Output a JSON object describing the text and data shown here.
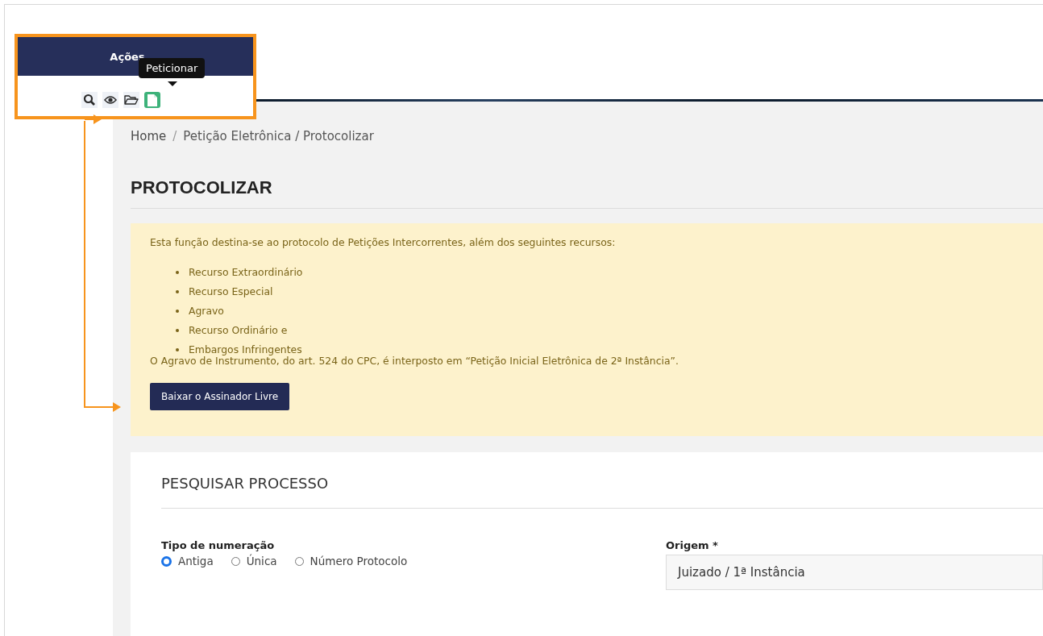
{
  "breadcrumb": [
    {
      "kind": "link",
      "text": "Home"
    },
    {
      "kind": "separator",
      "text": "/"
    },
    {
      "kind": "current",
      "text": "Petição Eletrônica / Protocolizar"
    }
  ],
  "title": "PROTOCOLIZAR",
  "alert": {
    "intro": "Esta função destina-se ao protocolo de Petições Intercorrentes, além dos seguintes recursos:",
    "items": [
      "Recurso Extraordinário",
      "Recurso Especial",
      "Agravo",
      "Recurso Ordinário e",
      "Embargos Infringentes"
    ],
    "note": "O Agravo de Instrumento, do art. 524 do CPC, é interposto em “Petição Inicial Eletrônica de 2ª Instância”.",
    "button": "Baixar o Assinador Livre"
  },
  "search_card": {
    "title": "PESQUISAR PROCESSO",
    "numbering": {
      "label": "Tipo de numeração",
      "options": [
        {
          "label": "Antiga",
          "selected": true
        },
        {
          "label": "Única",
          "selected": false
        },
        {
          "label": "Número Protocolo",
          "selected": false
        }
      ]
    },
    "origin": {
      "label": "Origem *",
      "value": "Juizado / 1ª Instância"
    }
  },
  "callout": {
    "header": "Ações",
    "tooltip": "Peticionar",
    "icons": [
      {
        "kind": "search",
        "selected": false
      },
      {
        "kind": "eye",
        "selected": false
      },
      {
        "kind": "folder",
        "selected": false
      },
      {
        "kind": "document",
        "selected": true
      }
    ]
  }
}
